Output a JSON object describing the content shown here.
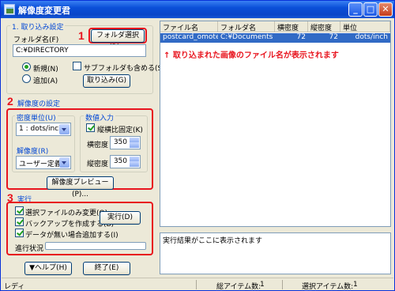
{
  "window": {
    "title": "解像度変更君",
    "minimize": "_",
    "maximize": "□",
    "close": "✕"
  },
  "section1": {
    "title": "1. 取り込み設定",
    "folder_label": "フォルダ名(F)",
    "folder_select_button": "フォルダ選択(R)...",
    "folder_value": "C:¥DIRECTORY",
    "radio_new": "新規(N)",
    "radio_add": "追加(A)",
    "subfolder_checkbox": "サブフォルダも含める(S)",
    "import_button": "取り込み(G)",
    "marker": "1"
  },
  "section2": {
    "title": "解像度の設定",
    "density_unit_group": "密度単位(U)",
    "density_unit_value": "1 : dots/inch",
    "resolution_group": "解像度(R)",
    "resolution_value": "ユーザー定義",
    "numeric_group": "数値入力",
    "aspect_checkbox": "縦横比固定(K)",
    "h_density_label": "横密度",
    "h_density_value": "350",
    "v_density_label": "縦密度",
    "v_density_value": "350",
    "preview_button": "解像度プレビュー(P)...",
    "marker": "2"
  },
  "section3": {
    "title": "実行",
    "option1": "選択ファイルのみ変更(O)",
    "option2": "バックアップを作成する(B)",
    "option3": "データが無い場合追加する(I)",
    "run_button": "実行(D)",
    "progress_label": "進行状況",
    "progress": 0,
    "marker": "3"
  },
  "bottom_buttons": {
    "help": "▼ヘルプ(H)",
    "exit": "終了(E)"
  },
  "file_list": {
    "columns": [
      "ファイル名",
      "フォルダ名",
      "横密度",
      "縦密度",
      "単位"
    ],
    "rows": [
      {
        "file": "postcard_omote.jpg",
        "folder": "C:¥Documents ...",
        "h": "72",
        "v": "72",
        "unit": "dots/inch"
      }
    ]
  },
  "annotation": "↑ 取り込まれた画像のファイル名が表示されます",
  "result_text": "実行結果がここに表示されます",
  "status": {
    "ready": "レディ",
    "total_label": "総アイテム数:",
    "total_value": "1",
    "selected_label": "選択アイテム数:",
    "selected_value": "1"
  },
  "colors": {
    "highlight": "#e8141e",
    "selection": "#316ac5",
    "titlebar": "#0a4fd8"
  }
}
